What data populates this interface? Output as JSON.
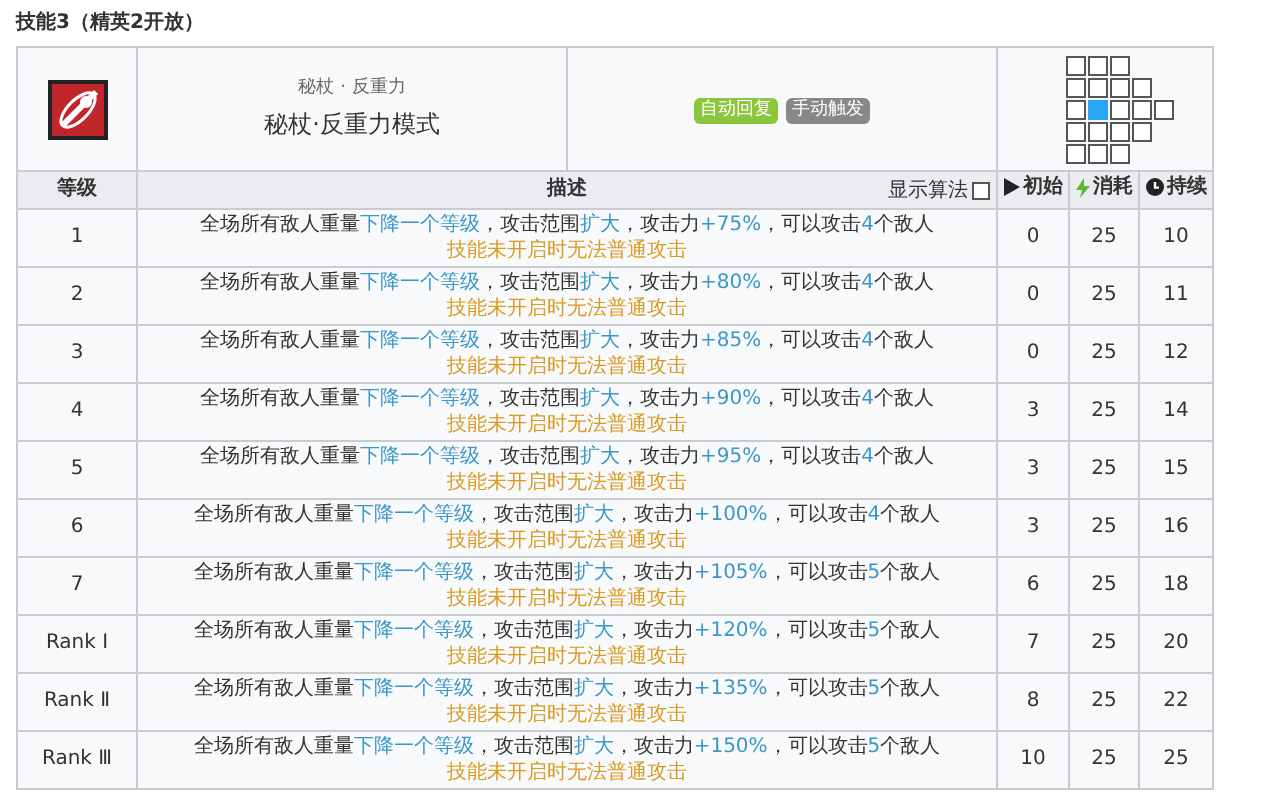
{
  "section_title": "技能3（精英2开放）",
  "skill": {
    "subtitle": "秘杖 · 反重力",
    "name": "秘杖·反重力模式",
    "tags": [
      {
        "label": "自动回复",
        "color": "#8cc63f"
      },
      {
        "label": "手动触发",
        "color": "#888888"
      }
    ],
    "range_rows": [
      {
        "cells": [
          {
            "self": false
          },
          {
            "self": false
          },
          {
            "self": false
          }
        ]
      },
      {
        "cells": [
          {
            "self": false
          },
          {
            "self": false
          },
          {
            "self": false
          },
          {
            "self": false
          }
        ]
      },
      {
        "cells": [
          {
            "self": false
          },
          {
            "self": true
          },
          {
            "self": false
          },
          {
            "self": false
          },
          {
            "self": false
          }
        ]
      },
      {
        "cells": [
          {
            "self": false
          },
          {
            "self": false
          },
          {
            "self": false
          },
          {
            "self": false
          }
        ]
      },
      {
        "cells": [
          {
            "self": false
          },
          {
            "self": false
          },
          {
            "self": false
          }
        ]
      }
    ]
  },
  "table": {
    "columns": [
      {
        "kind": "level",
        "label": "等级"
      },
      {
        "kind": "description",
        "label": "描述"
      },
      {
        "kind": "initial",
        "label": "初始"
      },
      {
        "kind": "cost",
        "label": "消耗"
      },
      {
        "kind": "duration",
        "label": "持续"
      }
    ],
    "show_formula": {
      "label": "显示算法",
      "checked": false
    },
    "rows": [
      {
        "level": "1",
        "description": [
          {
            "text": "全场所有敌人重量",
            "highlight": false
          },
          {
            "text": "下降一个等级",
            "highlight": true
          },
          {
            "text": "，攻击范围",
            "highlight": false
          },
          {
            "text": "扩大",
            "highlight": true
          },
          {
            "text": "，攻击力",
            "highlight": false
          },
          {
            "text": "+75%",
            "highlight": true
          },
          {
            "text": "，可以攻击",
            "highlight": false
          },
          {
            "text": "4",
            "highlight": true
          },
          {
            "text": "个敌人",
            "highlight": false
          }
        ],
        "note": "技能未开启时无法普通攻击",
        "initial": "0",
        "cost": "25",
        "duration": "10"
      },
      {
        "level": "2",
        "description": [
          {
            "text": "全场所有敌人重量",
            "highlight": false
          },
          {
            "text": "下降一个等级",
            "highlight": true
          },
          {
            "text": "，攻击范围",
            "highlight": false
          },
          {
            "text": "扩大",
            "highlight": true
          },
          {
            "text": "，攻击力",
            "highlight": false
          },
          {
            "text": "+80%",
            "highlight": true
          },
          {
            "text": "，可以攻击",
            "highlight": false
          },
          {
            "text": "4",
            "highlight": true
          },
          {
            "text": "个敌人",
            "highlight": false
          }
        ],
        "note": "技能未开启时无法普通攻击",
        "initial": "0",
        "cost": "25",
        "duration": "11"
      },
      {
        "level": "3",
        "description": [
          {
            "text": "全场所有敌人重量",
            "highlight": false
          },
          {
            "text": "下降一个等级",
            "highlight": true
          },
          {
            "text": "，攻击范围",
            "highlight": false
          },
          {
            "text": "扩大",
            "highlight": true
          },
          {
            "text": "，攻击力",
            "highlight": false
          },
          {
            "text": "+85%",
            "highlight": true
          },
          {
            "text": "，可以攻击",
            "highlight": false
          },
          {
            "text": "4",
            "highlight": true
          },
          {
            "text": "个敌人",
            "highlight": false
          }
        ],
        "note": "技能未开启时无法普通攻击",
        "initial": "0",
        "cost": "25",
        "duration": "12"
      },
      {
        "level": "4",
        "description": [
          {
            "text": "全场所有敌人重量",
            "highlight": false
          },
          {
            "text": "下降一个等级",
            "highlight": true
          },
          {
            "text": "，攻击范围",
            "highlight": false
          },
          {
            "text": "扩大",
            "highlight": true
          },
          {
            "text": "，攻击力",
            "highlight": false
          },
          {
            "text": "+90%",
            "highlight": true
          },
          {
            "text": "，可以攻击",
            "highlight": false
          },
          {
            "text": "4",
            "highlight": true
          },
          {
            "text": "个敌人",
            "highlight": false
          }
        ],
        "note": "技能未开启时无法普通攻击",
        "initial": "3",
        "cost": "25",
        "duration": "14"
      },
      {
        "level": "5",
        "description": [
          {
            "text": "全场所有敌人重量",
            "highlight": false
          },
          {
            "text": "下降一个等级",
            "highlight": true
          },
          {
            "text": "，攻击范围",
            "highlight": false
          },
          {
            "text": "扩大",
            "highlight": true
          },
          {
            "text": "，攻击力",
            "highlight": false
          },
          {
            "text": "+95%",
            "highlight": true
          },
          {
            "text": "，可以攻击",
            "highlight": false
          },
          {
            "text": "4",
            "highlight": true
          },
          {
            "text": "个敌人",
            "highlight": false
          }
        ],
        "note": "技能未开启时无法普通攻击",
        "initial": "3",
        "cost": "25",
        "duration": "15"
      },
      {
        "level": "6",
        "description": [
          {
            "text": "全场所有敌人重量",
            "highlight": false
          },
          {
            "text": "下降一个等级",
            "highlight": true
          },
          {
            "text": "，攻击范围",
            "highlight": false
          },
          {
            "text": "扩大",
            "highlight": true
          },
          {
            "text": "，攻击力",
            "highlight": false
          },
          {
            "text": "+100%",
            "highlight": true
          },
          {
            "text": "，可以攻击",
            "highlight": false
          },
          {
            "text": "4",
            "highlight": true
          },
          {
            "text": "个敌人",
            "highlight": false
          }
        ],
        "note": "技能未开启时无法普通攻击",
        "initial": "3",
        "cost": "25",
        "duration": "16"
      },
      {
        "level": "7",
        "description": [
          {
            "text": "全场所有敌人重量",
            "highlight": false
          },
          {
            "text": "下降一个等级",
            "highlight": true
          },
          {
            "text": "，攻击范围",
            "highlight": false
          },
          {
            "text": "扩大",
            "highlight": true
          },
          {
            "text": "，攻击力",
            "highlight": false
          },
          {
            "text": "+105%",
            "highlight": true
          },
          {
            "text": "，可以攻击",
            "highlight": false
          },
          {
            "text": "5",
            "highlight": true
          },
          {
            "text": "个敌人",
            "highlight": false
          }
        ],
        "note": "技能未开启时无法普通攻击",
        "initial": "6",
        "cost": "25",
        "duration": "18"
      },
      {
        "level": "Rank Ⅰ",
        "description": [
          {
            "text": "全场所有敌人重量",
            "highlight": false
          },
          {
            "text": "下降一个等级",
            "highlight": true
          },
          {
            "text": "，攻击范围",
            "highlight": false
          },
          {
            "text": "扩大",
            "highlight": true
          },
          {
            "text": "，攻击力",
            "highlight": false
          },
          {
            "text": "+120%",
            "highlight": true
          },
          {
            "text": "，可以攻击",
            "highlight": false
          },
          {
            "text": "5",
            "highlight": true
          },
          {
            "text": "个敌人",
            "highlight": false
          }
        ],
        "note": "技能未开启时无法普通攻击",
        "initial": "7",
        "cost": "25",
        "duration": "20"
      },
      {
        "level": "Rank Ⅱ",
        "description": [
          {
            "text": "全场所有敌人重量",
            "highlight": false
          },
          {
            "text": "下降一个等级",
            "highlight": true
          },
          {
            "text": "，攻击范围",
            "highlight": false
          },
          {
            "text": "扩大",
            "highlight": true
          },
          {
            "text": "，攻击力",
            "highlight": false
          },
          {
            "text": "+135%",
            "highlight": true
          },
          {
            "text": "，可以攻击",
            "highlight": false
          },
          {
            "text": "5",
            "highlight": true
          },
          {
            "text": "个敌人",
            "highlight": false
          }
        ],
        "note": "技能未开启时无法普通攻击",
        "initial": "8",
        "cost": "25",
        "duration": "22"
      },
      {
        "level": "Rank Ⅲ",
        "description": [
          {
            "text": "全场所有敌人重量",
            "highlight": false
          },
          {
            "text": "下降一个等级",
            "highlight": true
          },
          {
            "text": "，攻击范围",
            "highlight": false
          },
          {
            "text": "扩大",
            "highlight": true
          },
          {
            "text": "，攻击力",
            "highlight": false
          },
          {
            "text": "+150%",
            "highlight": true
          },
          {
            "text": "，可以攻击",
            "highlight": false
          },
          {
            "text": "5",
            "highlight": true
          },
          {
            "text": "个敌人",
            "highlight": false
          }
        ],
        "note": "技能未开启时无法普通攻击",
        "initial": "10",
        "cost": "25",
        "duration": "25"
      }
    ]
  }
}
